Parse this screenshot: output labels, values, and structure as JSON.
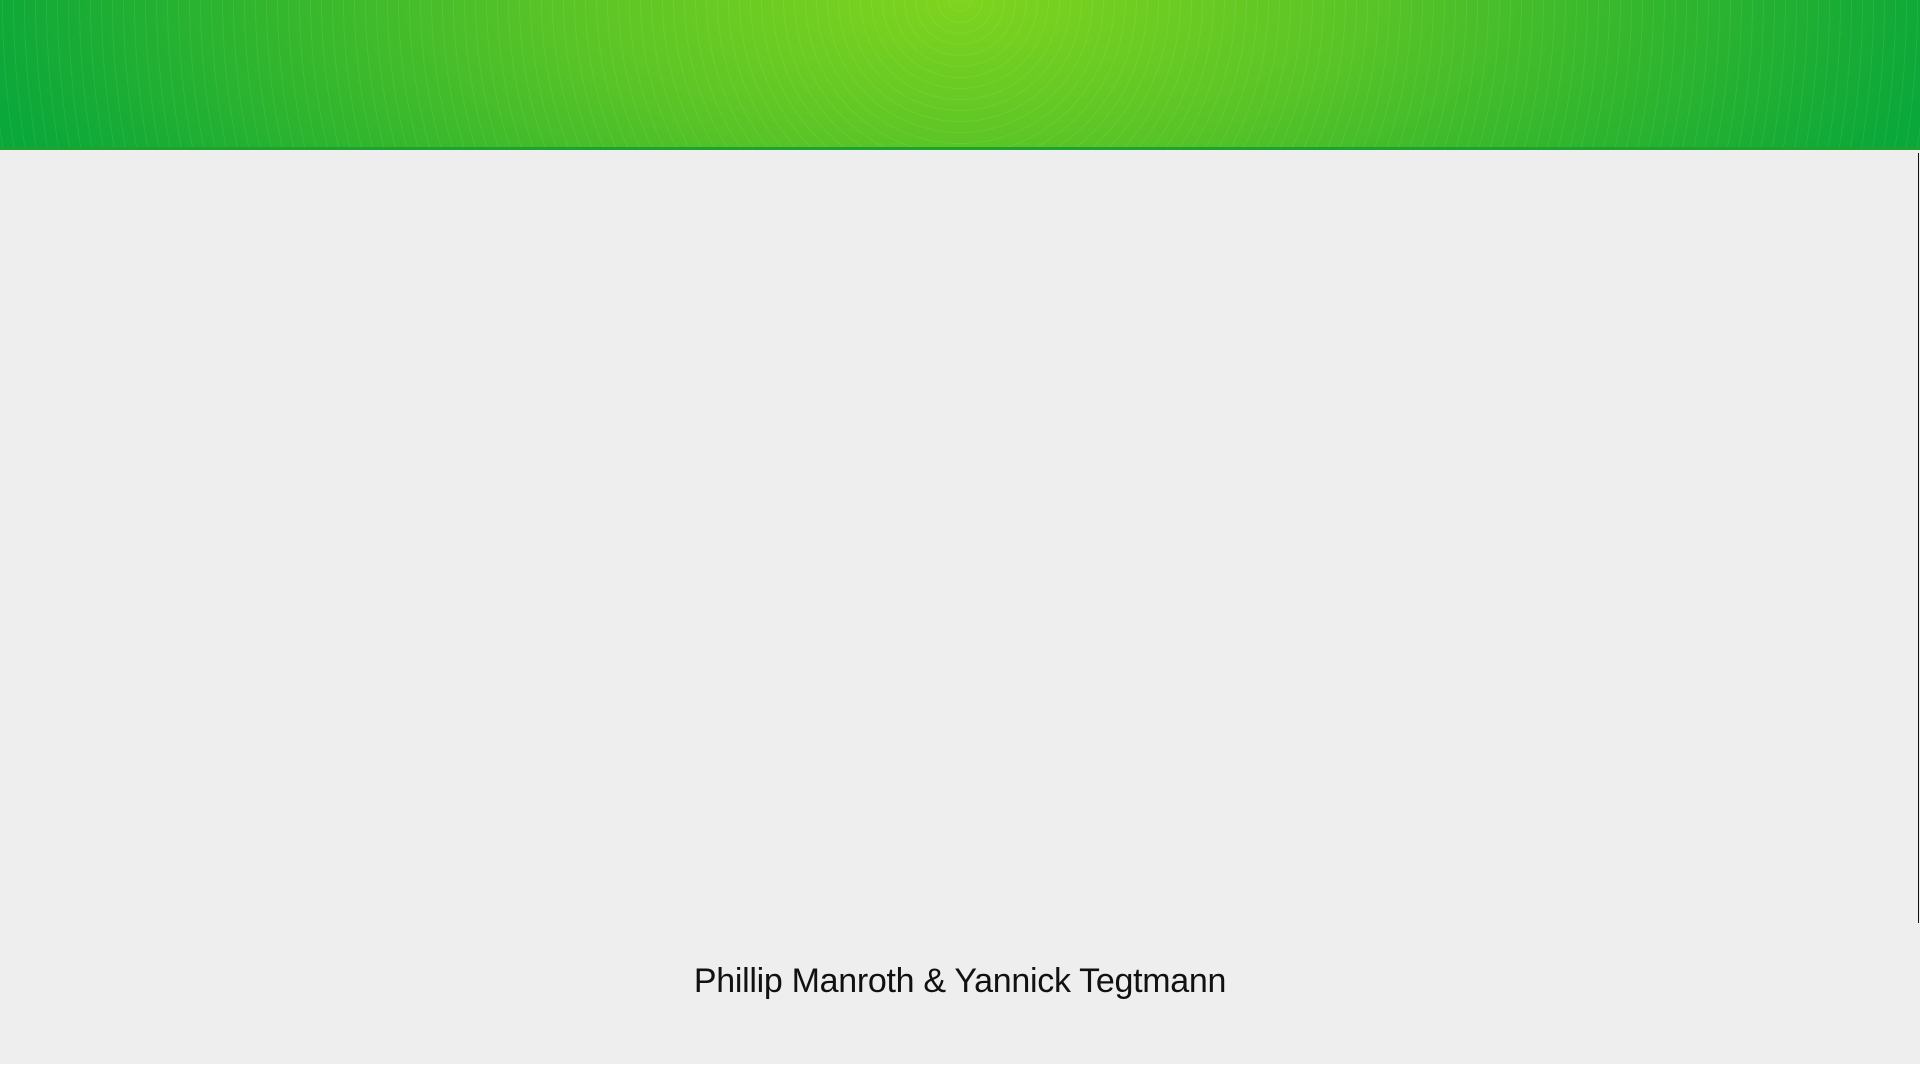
{
  "header": {
    "style": "green-radial-banner",
    "colors": {
      "center": "#7fd41e",
      "edge": "#0aa73a",
      "border": "#1ca52c"
    }
  },
  "page": {
    "background": "#eeeeee"
  },
  "footer": {
    "credit": "Phillip Manroth & Yannick Tegtmann"
  }
}
